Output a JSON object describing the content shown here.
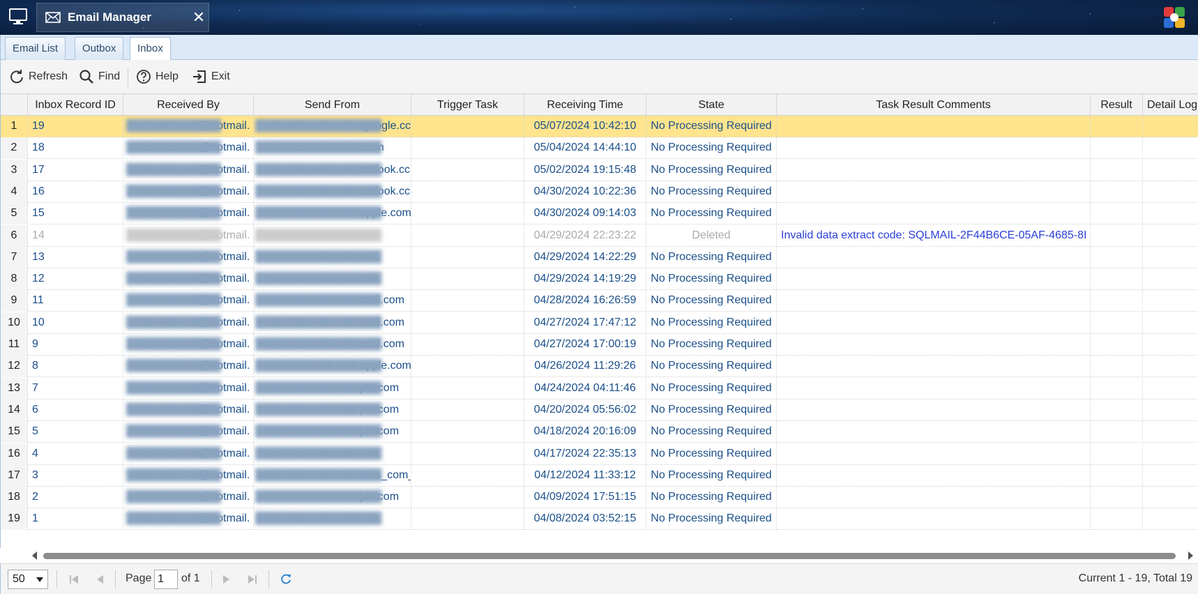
{
  "window": {
    "title": "Email Manager"
  },
  "tabs": [
    {
      "label": "Email List"
    },
    {
      "label": "Outbox"
    },
    {
      "label": "Inbox"
    }
  ],
  "toolbar": {
    "refresh": "Refresh",
    "find": "Find",
    "help": "Help",
    "exit": "Exit"
  },
  "columns": [
    "Inbox Record ID",
    "Received By",
    "Send From",
    "Trigger Task",
    "Receiving Time",
    "State",
    "Task Result Comments",
    "Result",
    "Detail Log"
  ],
  "rows": [
    {
      "n": "1",
      "id": "19",
      "received_by": "@hotmail.",
      "send_from": ".google.cc",
      "time": "05/07/2024 10:42:10",
      "state": "No Processing Required",
      "comment": ""
    },
    {
      "n": "2",
      "id": "18",
      "received_by": "@hotmail.",
      "send_from": ".com",
      "time": "05/04/2024 14:44:10",
      "state": "No Processing Required",
      "comment": ""
    },
    {
      "n": "3",
      "id": "17",
      "received_by": "@hotmail.",
      "send_from": "outlook.cc",
      "time": "05/02/2024 19:15:48",
      "state": "No Processing Required",
      "comment": ""
    },
    {
      "n": "4",
      "id": "16",
      "received_by": "@hotmail.",
      "send_from": "outlook.cc",
      "time": "04/30/2024 10:22:36",
      "state": "No Processing Required",
      "comment": ""
    },
    {
      "n": "5",
      "id": "15",
      "received_by": "@hotmail.",
      "send_from": "apple.com",
      "time": "04/30/2024 09:14:03",
      "state": "No Processing Required",
      "comment": ""
    },
    {
      "n": "6",
      "id": "14",
      "received_by": "@hotmail.",
      "send_from": "m",
      "time": "04/29/2024 22:23:22",
      "state": "Deleted",
      "comment": "Invalid data extract code: SQLMAIL-2F44B6CE-05AF-4685-8I"
    },
    {
      "n": "7",
      "id": "13",
      "received_by": "@hotmail.",
      "send_from": "m",
      "time": "04/29/2024 14:22:29",
      "state": "No Processing Required",
      "comment": ""
    },
    {
      "n": "8",
      "id": "12",
      "received_by": "@hotmail.",
      "send_from": "m",
      "time": "04/29/2024 14:19:29",
      "state": "No Processing Required",
      "comment": ""
    },
    {
      "n": "9",
      "id": "11",
      "received_by": "@hotmail.",
      "send_from": "mail.com",
      "time": "04/28/2024 16:26:59",
      "state": "No Processing Required",
      "comment": ""
    },
    {
      "n": "10",
      "id": "10",
      "received_by": "@hotmail.",
      "send_from": "mail.com",
      "time": "04/27/2024 17:47:12",
      "state": "No Processing Required",
      "comment": ""
    },
    {
      "n": "11",
      "id": "9",
      "received_by": "@hotmail.",
      "send_from": "mail.com",
      "time": "04/27/2024 17:00:19",
      "state": "No Processing Required",
      "comment": ""
    },
    {
      "n": "12",
      "id": "8",
      "received_by": "@hotmail.",
      "send_from": "apple.com",
      "time": "04/26/2024 11:29:26",
      "state": "No Processing Required",
      "comment": ""
    },
    {
      "n": "13",
      "id": "7",
      "received_by": "@hotmail.",
      "send_from": "ple.com",
      "time": "04/24/2024 04:11:46",
      "state": "No Processing Required",
      "comment": ""
    },
    {
      "n": "14",
      "id": "6",
      "received_by": "@hotmail.",
      "send_from": "ple.com",
      "time": "04/20/2024 05:56:02",
      "state": "No Processing Required",
      "comment": ""
    },
    {
      "n": "15",
      "id": "5",
      "received_by": "@hotmail.",
      "send_from": "ple.com",
      "time": "04/18/2024 20:16:09",
      "state": "No Processing Required",
      "comment": ""
    },
    {
      "n": "16",
      "id": "4",
      "received_by": "@hotmail.",
      "send_from": "",
      "time": "04/17/2024 22:35:13",
      "state": "No Processing Required",
      "comment": ""
    },
    {
      "n": "17",
      "id": "3",
      "received_by": "@hotmail.",
      "send_from": "otes_com_",
      "time": "04/12/2024 11:33:12",
      "state": "No Processing Required",
      "comment": ""
    },
    {
      "n": "18",
      "id": "2",
      "received_by": "@hotmail.",
      "send_from": "ple.com",
      "time": "04/09/2024 17:51:15",
      "state": "No Processing Required",
      "comment": ""
    },
    {
      "n": "19",
      "id": "1",
      "received_by": "@hotmail.",
      "send_from": "",
      "time": "04/08/2024 03:52:15",
      "state": "No Processing Required",
      "comment": ""
    }
  ],
  "pager": {
    "page_size": "50",
    "page_label": "Page",
    "page_value": "1",
    "of_label": "of 1",
    "info": "Current 1 - 19, Total 19"
  },
  "colors": {
    "selected_row": "#ffe48d",
    "link_text": "#1b4f8a",
    "deleted_text": "#aaaaaa",
    "comment_text": "#2b3fd8",
    "tab_bar": "#dce9f8"
  }
}
